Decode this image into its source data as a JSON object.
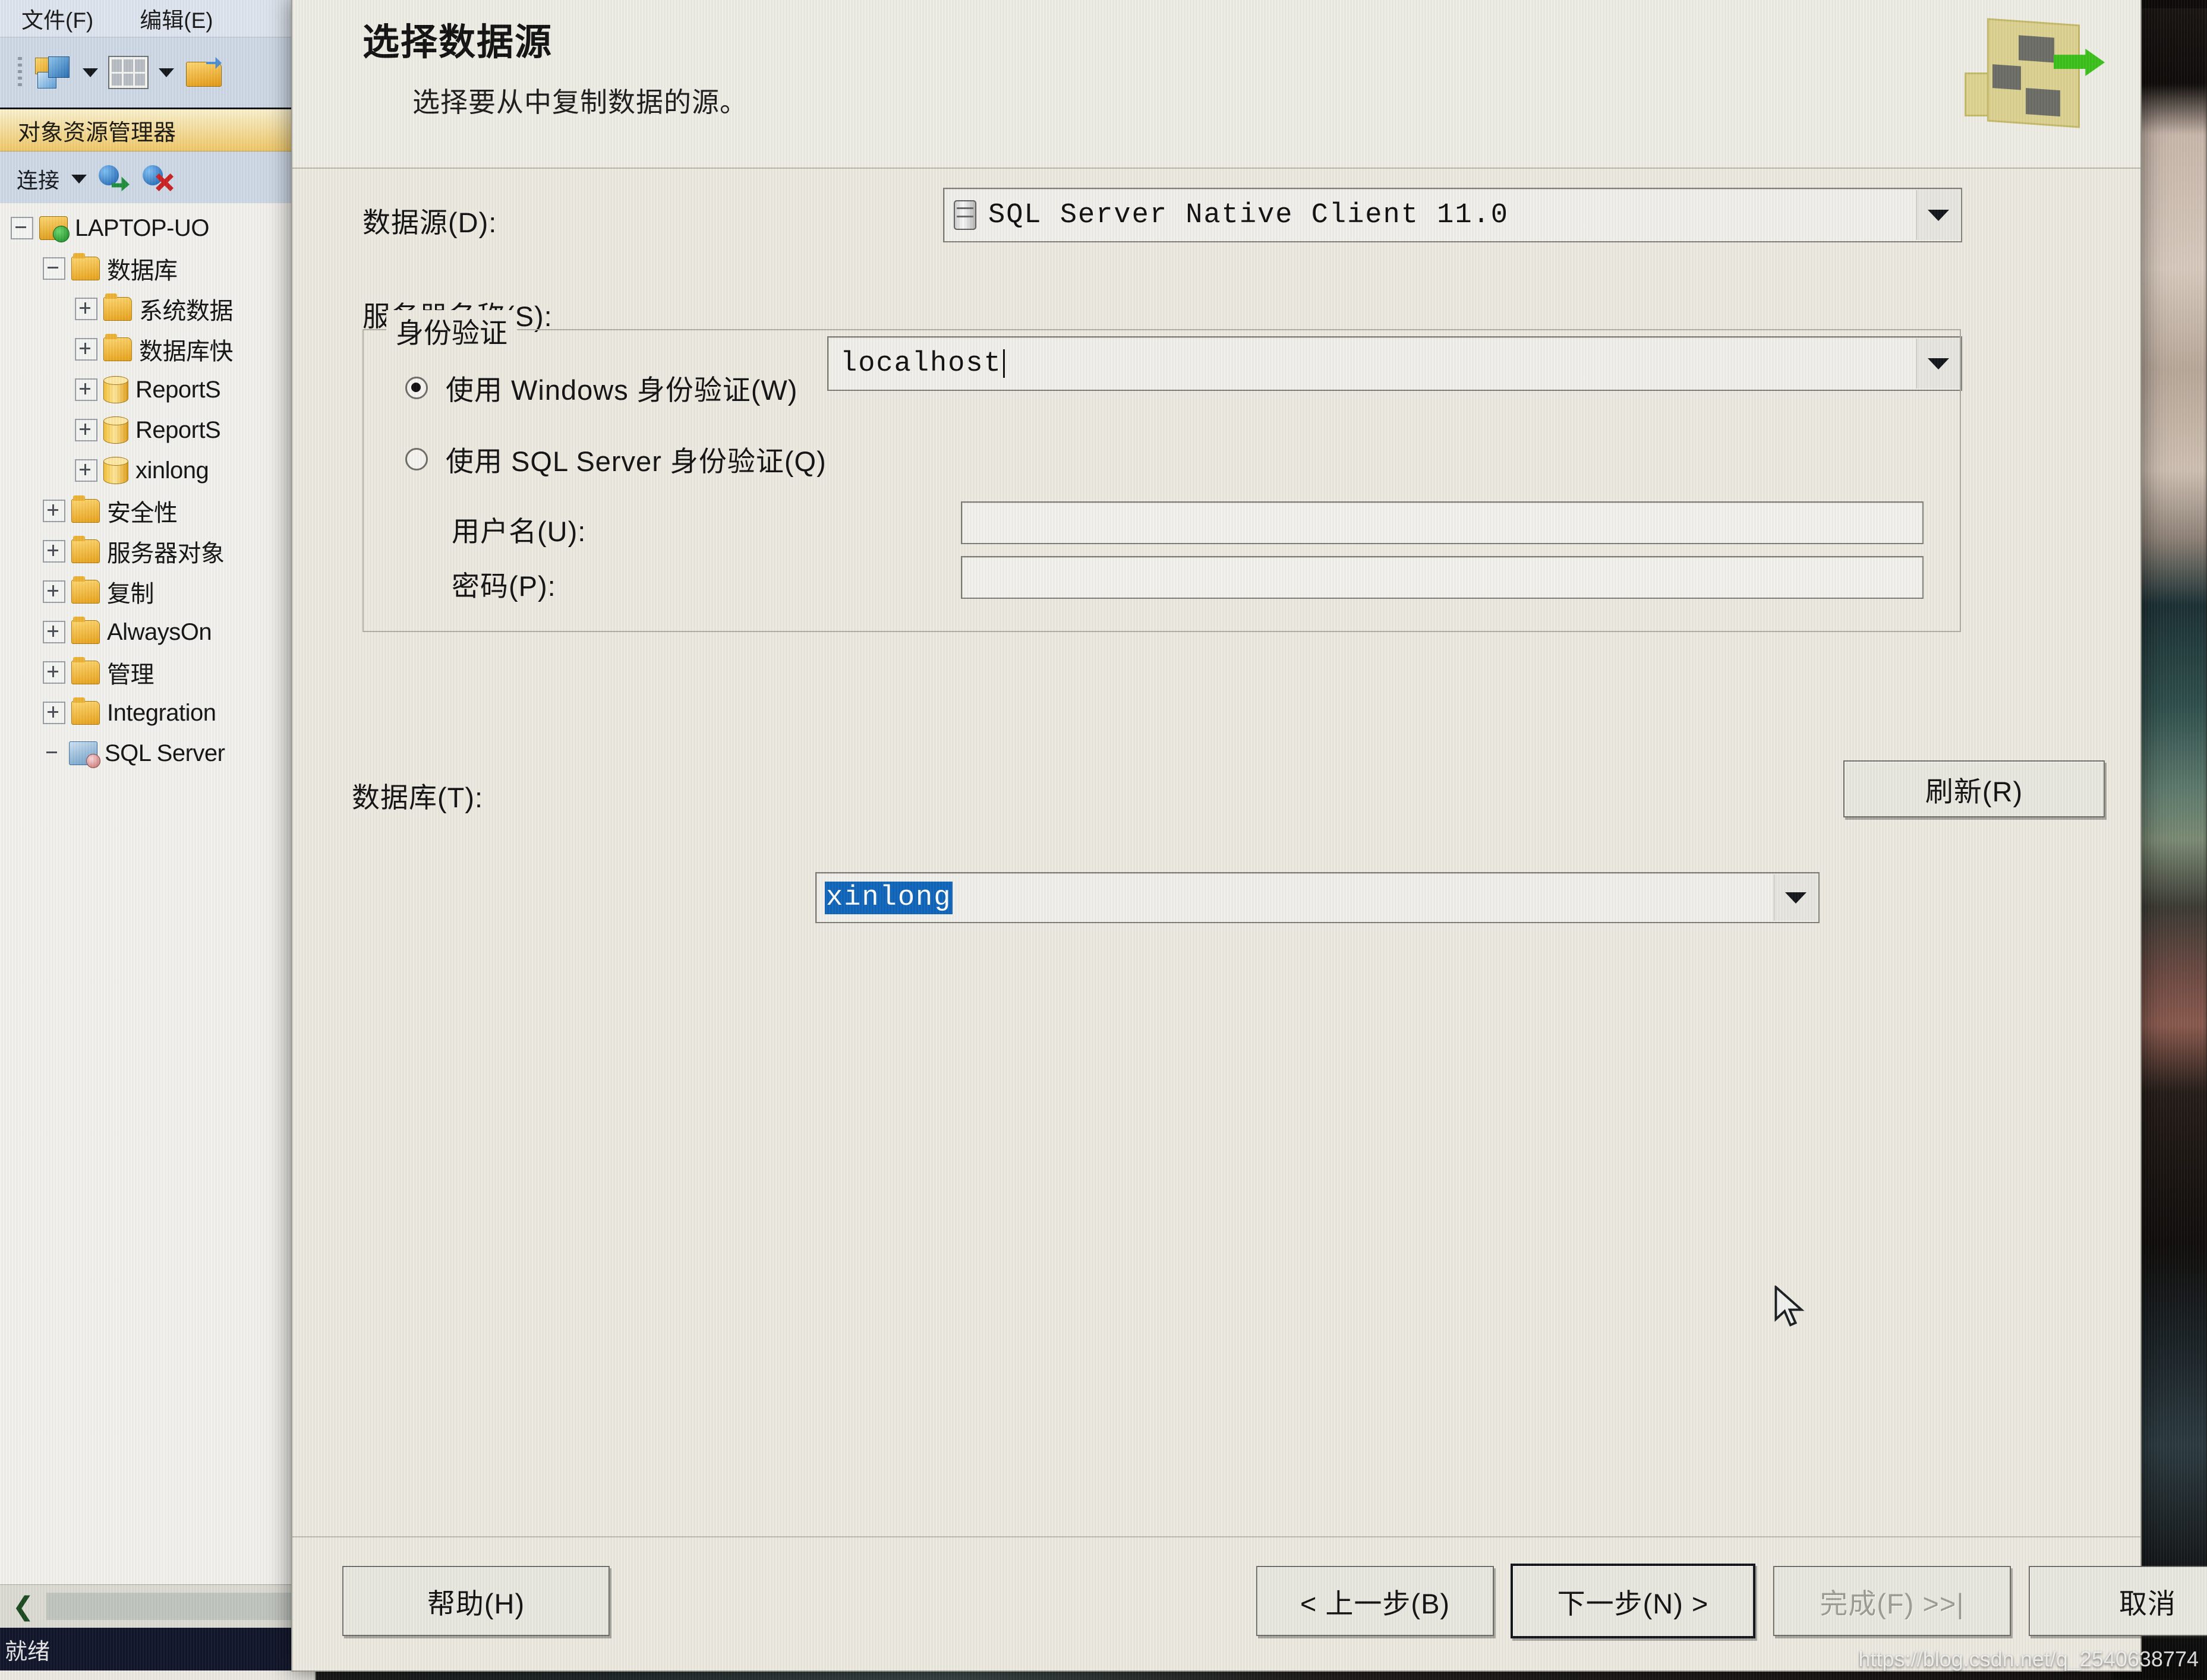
{
  "app": {
    "menu": [
      "文件(F)",
      "编辑(E)"
    ],
    "explorer_panel_title": "对象资源管理器",
    "connect_label": "连接",
    "status_text": "就绪",
    "collapse_glyph": "❮"
  },
  "tree": [
    {
      "label": "LAPTOP-UO",
      "icon": "server-icon",
      "expander": "minus",
      "indent": 0
    },
    {
      "label": "数据库",
      "icon": "folder-icon",
      "expander": "minus",
      "indent": 1
    },
    {
      "label": "系统数据",
      "icon": "folder-icon",
      "expander": "plus",
      "indent": 2
    },
    {
      "label": "数据库快",
      "icon": "folder-icon",
      "expander": "plus",
      "indent": 2
    },
    {
      "label": "ReportS",
      "icon": "database-icon",
      "expander": "plus",
      "indent": 2
    },
    {
      "label": "ReportS",
      "icon": "database-icon",
      "expander": "plus",
      "indent": 2
    },
    {
      "label": "xinlong",
      "icon": "database-icon",
      "expander": "plus",
      "indent": 2
    },
    {
      "label": "安全性",
      "icon": "folder-icon",
      "expander": "plus",
      "indent": 1
    },
    {
      "label": "服务器对象",
      "icon": "folder-icon",
      "expander": "plus",
      "indent": 1
    },
    {
      "label": "复制",
      "icon": "folder-icon",
      "expander": "plus",
      "indent": 1
    },
    {
      "label": "AlwaysOn",
      "icon": "folder-icon",
      "expander": "plus",
      "indent": 1
    },
    {
      "label": "管理",
      "icon": "folder-icon",
      "expander": "plus",
      "indent": 1
    },
    {
      "label": "Integration",
      "icon": "folder-icon",
      "expander": "plus",
      "indent": 1
    },
    {
      "label": "SQL Server",
      "icon": "sql-agent-icon",
      "expander": "none",
      "indent": 1
    }
  ],
  "wizard": {
    "title": "选择数据源",
    "subtitle": "选择要从中复制数据的源。",
    "logo_icon": "import-export-wizard-icon",
    "data_source": {
      "label": "数据源(D):",
      "value": "SQL Server Native Client 11.0",
      "icon": "database-provider-icon"
    },
    "server_name": {
      "label": "服务器名称(S):",
      "value": "localhost"
    },
    "authentication": {
      "legend": "身份验证",
      "options": [
        {
          "label": "使用 Windows 身份验证(W)",
          "selected": true
        },
        {
          "label": "使用 SQL Server 身份验证(Q)",
          "selected": false
        }
      ],
      "username": {
        "label": "用户名(U):",
        "value": ""
      },
      "password": {
        "label": "密码(P):",
        "value": ""
      }
    },
    "database": {
      "label": "数据库(T):",
      "value": "xinlong",
      "selected": true,
      "refresh_button": "刷新(R)"
    },
    "footer_buttons": [
      {
        "name": "help",
        "label": "帮助(H)",
        "state": "enabled"
      },
      {
        "name": "back",
        "label": "< 上一步(B)",
        "state": "enabled"
      },
      {
        "name": "next",
        "label": "下一步(N) >",
        "state": "default"
      },
      {
        "name": "finish",
        "label": "完成(F) >>|",
        "state": "disabled"
      },
      {
        "name": "cancel",
        "label": "取消",
        "state": "enabled"
      }
    ]
  },
  "colors": {
    "selection_blue": "#1166bb",
    "panel_header": "#f0c969",
    "dialog_face": "#eceae1",
    "status_bar": "#12162b"
  },
  "watermark": "https://blog.csdn.net/q_2540638774"
}
